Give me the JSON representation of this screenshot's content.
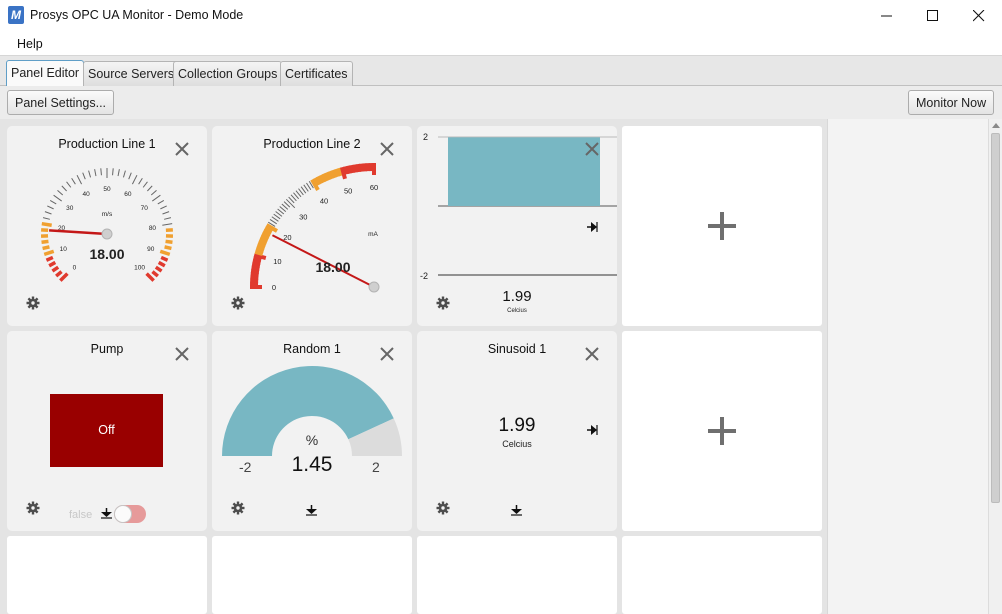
{
  "window": {
    "title": "Prosys OPC UA Monitor - Demo Mode",
    "icon_letter": "M",
    "accent": "#3a73c5"
  },
  "menu": {
    "help": "Help"
  },
  "tabs": [
    {
      "label": "Panel Editor",
      "active": true
    },
    {
      "label": "Source Servers",
      "active": false
    },
    {
      "label": "Collection Groups",
      "active": false
    },
    {
      "label": "Certificates",
      "active": false
    }
  ],
  "toolbar": {
    "panel_settings": "Panel Settings...",
    "monitor_now": "Monitor Now"
  },
  "panels": {
    "production_line_1": {
      "title": "Production Line 1",
      "value": "18.00",
      "unit": "m/s",
      "value_numeric": 18,
      "ticks": [
        "0",
        "10",
        "20",
        "30",
        "40",
        "50",
        "60",
        "70",
        "80",
        "90",
        "100"
      ]
    },
    "production_line_2": {
      "title": "Production Line 2",
      "value": "18.00",
      "unit": "mA",
      "value_numeric": 18,
      "ticks": [
        "0",
        "10",
        "20",
        "30",
        "40",
        "50",
        "60"
      ]
    },
    "bar_chart": {
      "axis_max": "2",
      "axis_min": "-2",
      "value": "1.99",
      "unit": "Celcius",
      "bar_color": "#78b7c3"
    },
    "pump": {
      "title": "Pump",
      "state": "Off",
      "state_color": "#990000",
      "toggle_label": "false"
    },
    "random_1": {
      "title": "Random 1",
      "value": "1.45",
      "unit": "%",
      "min": "-2",
      "max": "2",
      "value_numeric": 1.45,
      "fill_color": "#78b7c3"
    },
    "sinusoid_1": {
      "title": "Sinusoid 1",
      "value": "1.99",
      "unit": "Celcius"
    }
  },
  "icons": {
    "close": "close-icon",
    "settings": "gear-icon",
    "add": "plus-icon",
    "export": "arrow-right-icon",
    "collapse": "arrow-down-icon"
  }
}
